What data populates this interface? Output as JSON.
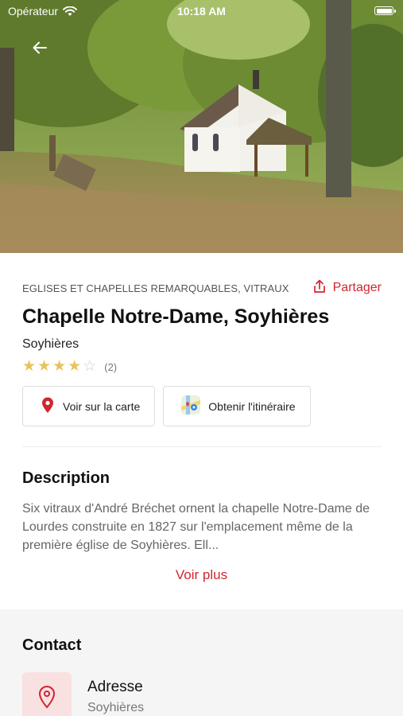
{
  "status_bar": {
    "carrier": "Opérateur",
    "time": "10:18 AM"
  },
  "place": {
    "category": "EGLISES ET CHAPELLES REMARQUABLES, VITRAUX",
    "share_label": "Partager",
    "title": "Chapelle Notre-Dame, Soyhières",
    "location": "Soyhières",
    "rating": {
      "value": 4,
      "max": 5,
      "count_text": "(2)"
    }
  },
  "actions": {
    "map_label": "Voir sur la carte",
    "route_label": "Obtenir l'itinéraire"
  },
  "description": {
    "heading": "Description",
    "text": "Six vitraux d'André Bréchet ornent la chapelle Notre-Dame de Lourdes construite en 1827 sur l'emplacement même de la première église de Soyhières. Ell...",
    "see_more": "Voir plus"
  },
  "contact": {
    "heading": "Contact",
    "address_label": "Adresse",
    "address_value": "Soyhières"
  },
  "colors": {
    "accent": "#d0262f",
    "star": "#e8c35a",
    "contact_icon_bg": "#f9e0e1"
  },
  "icons": {
    "back": "arrow-left-icon",
    "share": "share-icon",
    "map": "map-pin-icon",
    "route": "maps-app-icon",
    "address": "location-pin-icon",
    "wifi": "wifi-icon",
    "battery": "battery-icon"
  }
}
